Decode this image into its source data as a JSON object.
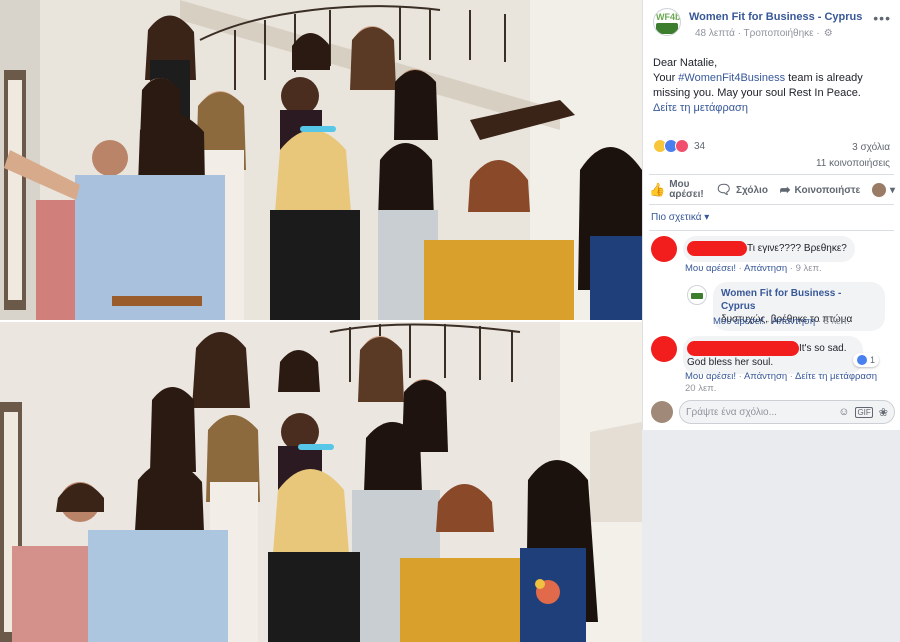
{
  "post": {
    "page_name": "Women Fit for Business - Cyprus",
    "logo_text": "WF4b",
    "time": "48 λεπτά · Τροποποιήθηκε ·",
    "more": "•••",
    "body": {
      "line1": "Dear Natalie,",
      "line2_prefix": "Your ",
      "hashtag": "#WomenFit4Business",
      "line2_suffix": " team is already missing you. May your soul Rest In Peace.",
      "see_translation": "Δείτε τη μετάφραση"
    },
    "reactions_count": "34",
    "comments_count": "3 σχόλια",
    "shares_count": "11 κοινοποιήσεις"
  },
  "actions": {
    "like_line1": "Μου",
    "like_line2": "αρέσει!",
    "comment": "Σχόλιο",
    "share": "Κοινοποιήστε",
    "share_caret": "▾"
  },
  "most_relevant": "Πιο σχετικά ▾",
  "comments": [
    {
      "text": "Τι εγινε???? Βρεθηκε?",
      "like": "Μου αρέσει!",
      "reply": "Απάντηση",
      "time": "9 λεπ."
    },
    {
      "author": "Women Fit for Business - Cyprus",
      "text": "δυστυχώς, βρέθηκε το πτώμα",
      "like": "Μου αρέσει!",
      "reply": "Απάντηση",
      "time": "8 λεπ."
    },
    {
      "text_line1": "It's so sad.",
      "text_line2": "God bless her soul.",
      "reaction_count": "1",
      "like": "Μου αρέσει!",
      "reply": "Απάντηση",
      "see_translation": "Δείτε τη μετάφραση",
      "time": "20 λεπ."
    }
  ],
  "write_comment": {
    "placeholder": "Γράψτε ένα σχόλιο..."
  },
  "icons": {
    "more": "more-horizontal-icon",
    "gear": "gear-icon",
    "like": "thumbs-up-icon",
    "comment": "comment-icon",
    "share": "share-icon",
    "emoji": "emoji-icon",
    "gif": "gif-icon",
    "sticker": "sticker-icon"
  },
  "colors": {
    "link": "#385898",
    "redaction": "#f21d1d",
    "brand_green": "#3c7d2e"
  }
}
